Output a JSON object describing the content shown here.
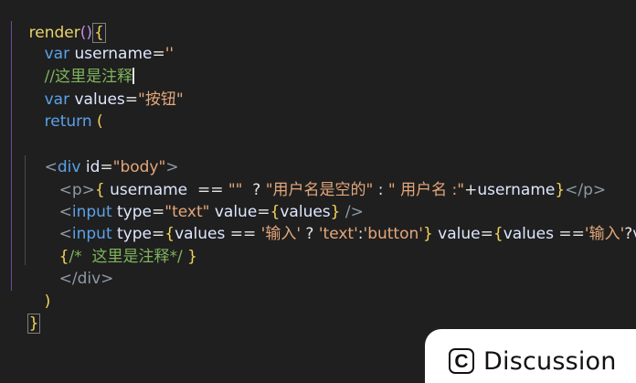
{
  "editor": {
    "line1": {
      "fn": "render",
      "paren": "()",
      "brace": "{"
    },
    "line2": {
      "kw": "var",
      "name": "username",
      "eq": "=",
      "value": "''"
    },
    "line3": {
      "comment": "//这里是注释"
    },
    "line4": {
      "kw": "var",
      "name": "values",
      "eq": "=",
      "value": "\"按钮\""
    },
    "line5": {
      "kw": "return",
      "paren": "("
    },
    "line7": {
      "lt": "<",
      "tag": "div",
      "attr": "id",
      "eq": "=",
      "value": "\"body\"",
      "gt": ">"
    },
    "line8": {
      "open": "<p>",
      "brace": "{",
      "expr1": " username",
      "op": "  == ",
      "str1": "\"\"",
      "q": "  ? ",
      "str2": "\"用户名是空的\"",
      "colon": " : ",
      "str3": "\" 用户名 :\"",
      "plus": "+",
      "expr2": "username",
      "brace_close": "}",
      "close": "</p>"
    },
    "line9": {
      "lt": "<",
      "tag": "input",
      "attr1": "type",
      "eq": "=",
      "val1": "\"text\"",
      "attr2": "value",
      "brace": "{",
      "expr": "values",
      "brace_close": "}",
      "end": " />"
    },
    "line10": {
      "lt": "<",
      "tag": "input",
      "attr1": "type",
      "eq": "=",
      "brace": "{",
      "expr1": "values",
      "op": " == ",
      "str1": "'输入'",
      "q": " ? ",
      "str2": "'text'",
      "colon": ":",
      "str3": "'button'",
      "brace_close": "}",
      "attr2": "value",
      "brace2": "{",
      "expr2": "values",
      "op2": " ==",
      "str4": "'输入'",
      "q2": "?",
      "expr3": "values",
      "colon2": " :\""
    },
    "line11": {
      "brace": "{",
      "comment": "/*  这里是注释*/",
      "brace_close": " }"
    },
    "line12": {
      "close": "</div>"
    },
    "line13": {
      "paren": ")"
    },
    "line14": {
      "brace": "}"
    }
  },
  "discussion_button": {
    "icon_glyph": "C",
    "icon": "discussion-icon",
    "label": "Discussion"
  }
}
